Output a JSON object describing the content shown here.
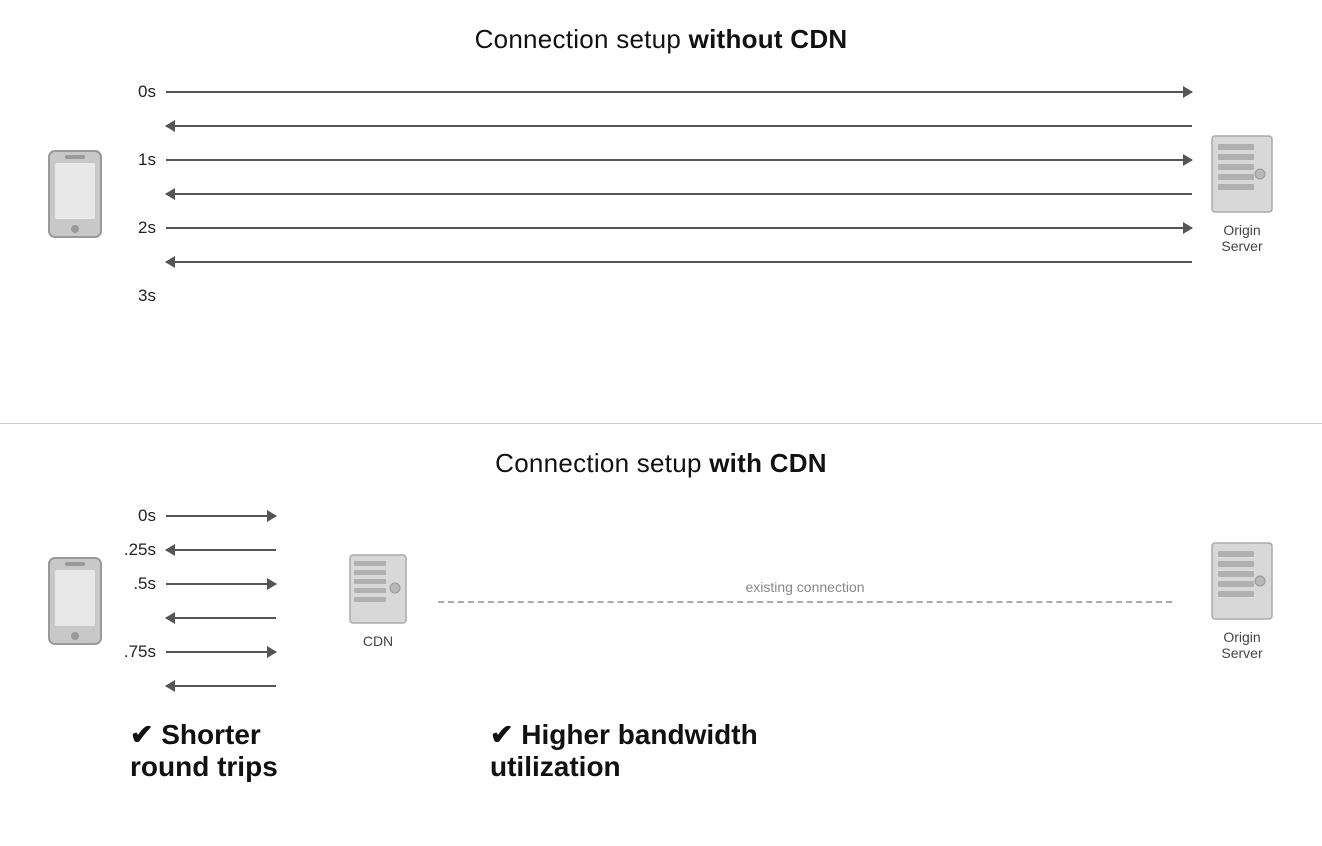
{
  "top_section": {
    "title_normal": "Connection setup ",
    "title_bold": "without CDN",
    "time_labels": [
      "0s",
      "1s",
      "2s",
      "3s"
    ],
    "server_label": "Origin\nServer"
  },
  "bottom_section": {
    "title_normal": "Connection setup ",
    "title_bold": "with CDN",
    "time_labels": [
      "0s",
      ".25s",
      ".5s",
      ".75s"
    ],
    "cdn_label": "CDN",
    "existing_connection_label": "existing connection",
    "server_label": "Origin\nServer",
    "benefit_left": "✔ Shorter\nround trips",
    "benefit_right": "✔ Higher bandwidth\nutilization"
  }
}
